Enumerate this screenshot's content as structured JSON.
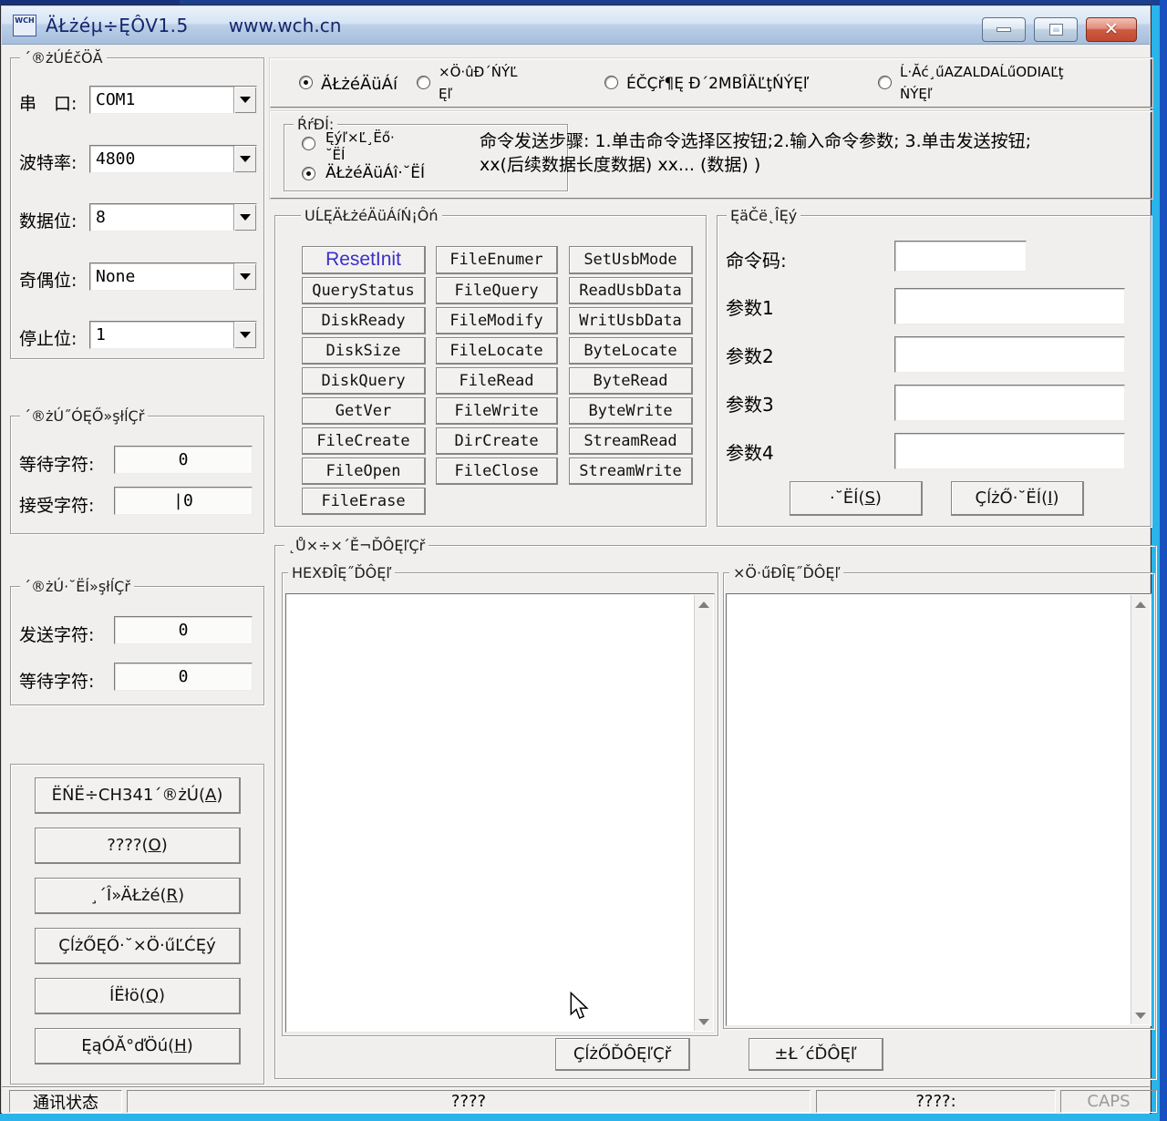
{
  "titlebar": {
    "logo_text": "WCH",
    "title": "ÄŁżéµ÷ĘÔV1.5",
    "url": "www.wch.cn"
  },
  "mode_radios": {
    "r1": "ÄŁżéÄüÁí",
    "r2_line1": "×Ö·ûĐ´ŃÝĽ",
    "r2_line2": "Ęľ",
    "r3": "ÉČÇř¶Ę Đ´2MBÎÄĽţŃÝĘľ",
    "r4_line1": "Ĺ·Ăć¸űAZALDAĹűODIAĽţ",
    "r4_line2": "ŃÝĘľ"
  },
  "type_group": {
    "title": "ŔŕĐÍ:",
    "r1_line1": "Ęýľ×Ľ¸Ëő·",
    "r1_line2": "˘ËÍ",
    "r2": "ÄŁżéÄüÁî·˘ËÍ"
  },
  "instructions": {
    "line1": "命令发送步骤: 1.单击命令选择区按钮;2.输入命令参数; 3.单击发送按钮;",
    "line2": "xx(后续数据长度数据) xx... (数据) )"
  },
  "serial_group": {
    "title": "´®żÚÉčÖĂ",
    "fields": [
      {
        "label": "串　口:",
        "value": "COM1"
      },
      {
        "label": "波特率:",
        "value": "4800"
      },
      {
        "label": "数据位:",
        "value": "8"
      },
      {
        "label": "奇偶位:",
        "value": "None"
      },
      {
        "label": "停止位:",
        "value": "1"
      }
    ]
  },
  "recv_group": {
    "title": "´®żÚ˝ÓĘŐ»şłĺÇř",
    "fields": [
      {
        "label": "等待字符:",
        "value": "0"
      },
      {
        "label": "接受字符:",
        "value": "|0"
      }
    ]
  },
  "send_group": {
    "title": "´®żÚ·˘ËÍ»şłĺÇř",
    "fields": [
      {
        "label": "发送字符:",
        "value": "0"
      },
      {
        "label": "等待字符:",
        "value": "0"
      }
    ]
  },
  "left_buttons": [
    "ËŃË÷CH341´®żÚ(A)",
    "????(O)",
    "¸´Î»ÄŁżé(R)",
    "ÇĺżŐĘŐ·˘×Ö·űĽĆĘý",
    "ÍËłö(Q)",
    "ĘąÓĂ°ďÖú(H)"
  ],
  "command_group": {
    "title": "UĹĘÄŁżéÄüÁíŃ¡Ôń",
    "col1": [
      "ResetInit",
      "QueryStatus",
      "DiskReady",
      "DiskSize",
      "DiskQuery",
      "GetVer",
      "FileCreate",
      "FileOpen",
      "FileErase"
    ],
    "col2": [
      "FileEnumer",
      "FileQuery",
      "FileModify",
      "FileLocate",
      "FileRead",
      "FileWrite",
      "DirCreate",
      "FileClose"
    ],
    "col3": [
      "SetUsbMode",
      "ReadUsbData",
      "WritUsbData",
      "ByteLocate",
      "ByteRead",
      "ByteWrite",
      "StreamRead",
      "StreamWrite"
    ]
  },
  "param_group": {
    "title": "ĘäČë˛ÎĘý",
    "cmd_label": "命令码:",
    "param_labels": [
      "参数1",
      "参数2",
      "参数3",
      "参数4"
    ],
    "cmd_value": "",
    "param_values": [
      "",
      "",
      "",
      ""
    ],
    "send_btn": "·˘ËÍ(S)",
    "clear_send_btn": "ÇĺżŐ·˘ËÍ(I)"
  },
  "display_group": {
    "title": "˛Ů×÷×´Ě¬ĎÔĘľÇř",
    "hex_title": "HEXĐÎĘ˝ĎÔĘľ",
    "char_title": "×Ö·űĐÎĘ˝ĎÔĘľ",
    "hex_content": "",
    "char_content": "",
    "clear_btn": "ÇĺżŐĎÔĘľÇř",
    "save_btn": "±Ł´ćĎÔĘľ"
  },
  "statusbar": {
    "s1": "通讯状态",
    "s2": "????",
    "s3": "????:",
    "s4": "CAPS"
  },
  "colors": {
    "accent_cyan": "#2ab4ea",
    "desktop_blue": "#1b3f91",
    "title_text": "#14266b",
    "reset_button_text": "#3b2fc9"
  }
}
